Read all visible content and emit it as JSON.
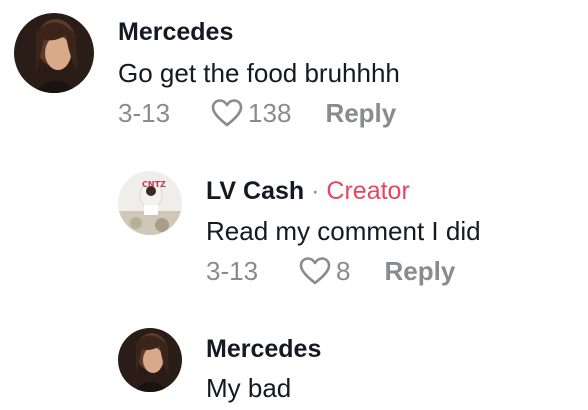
{
  "comments": [
    {
      "username": "Mercedes",
      "text": "Go get the food bruhhhh",
      "date": "3-13",
      "likes": "138",
      "reply_label": "Reply",
      "avatar": "profile-photo"
    },
    {
      "username": "LV Cash",
      "separator": "·",
      "badge": "Creator",
      "text": "Read my comment I did",
      "date": "3-13",
      "likes": "8",
      "reply_label": "Reply",
      "avatar": "profile-photo"
    },
    {
      "username": "Mercedes",
      "text": "My bad",
      "avatar": "profile-photo"
    }
  ],
  "colors": {
    "creator_badge": "#e8455e",
    "meta_gray": "#8a8b91",
    "text_dark": "#161823"
  }
}
